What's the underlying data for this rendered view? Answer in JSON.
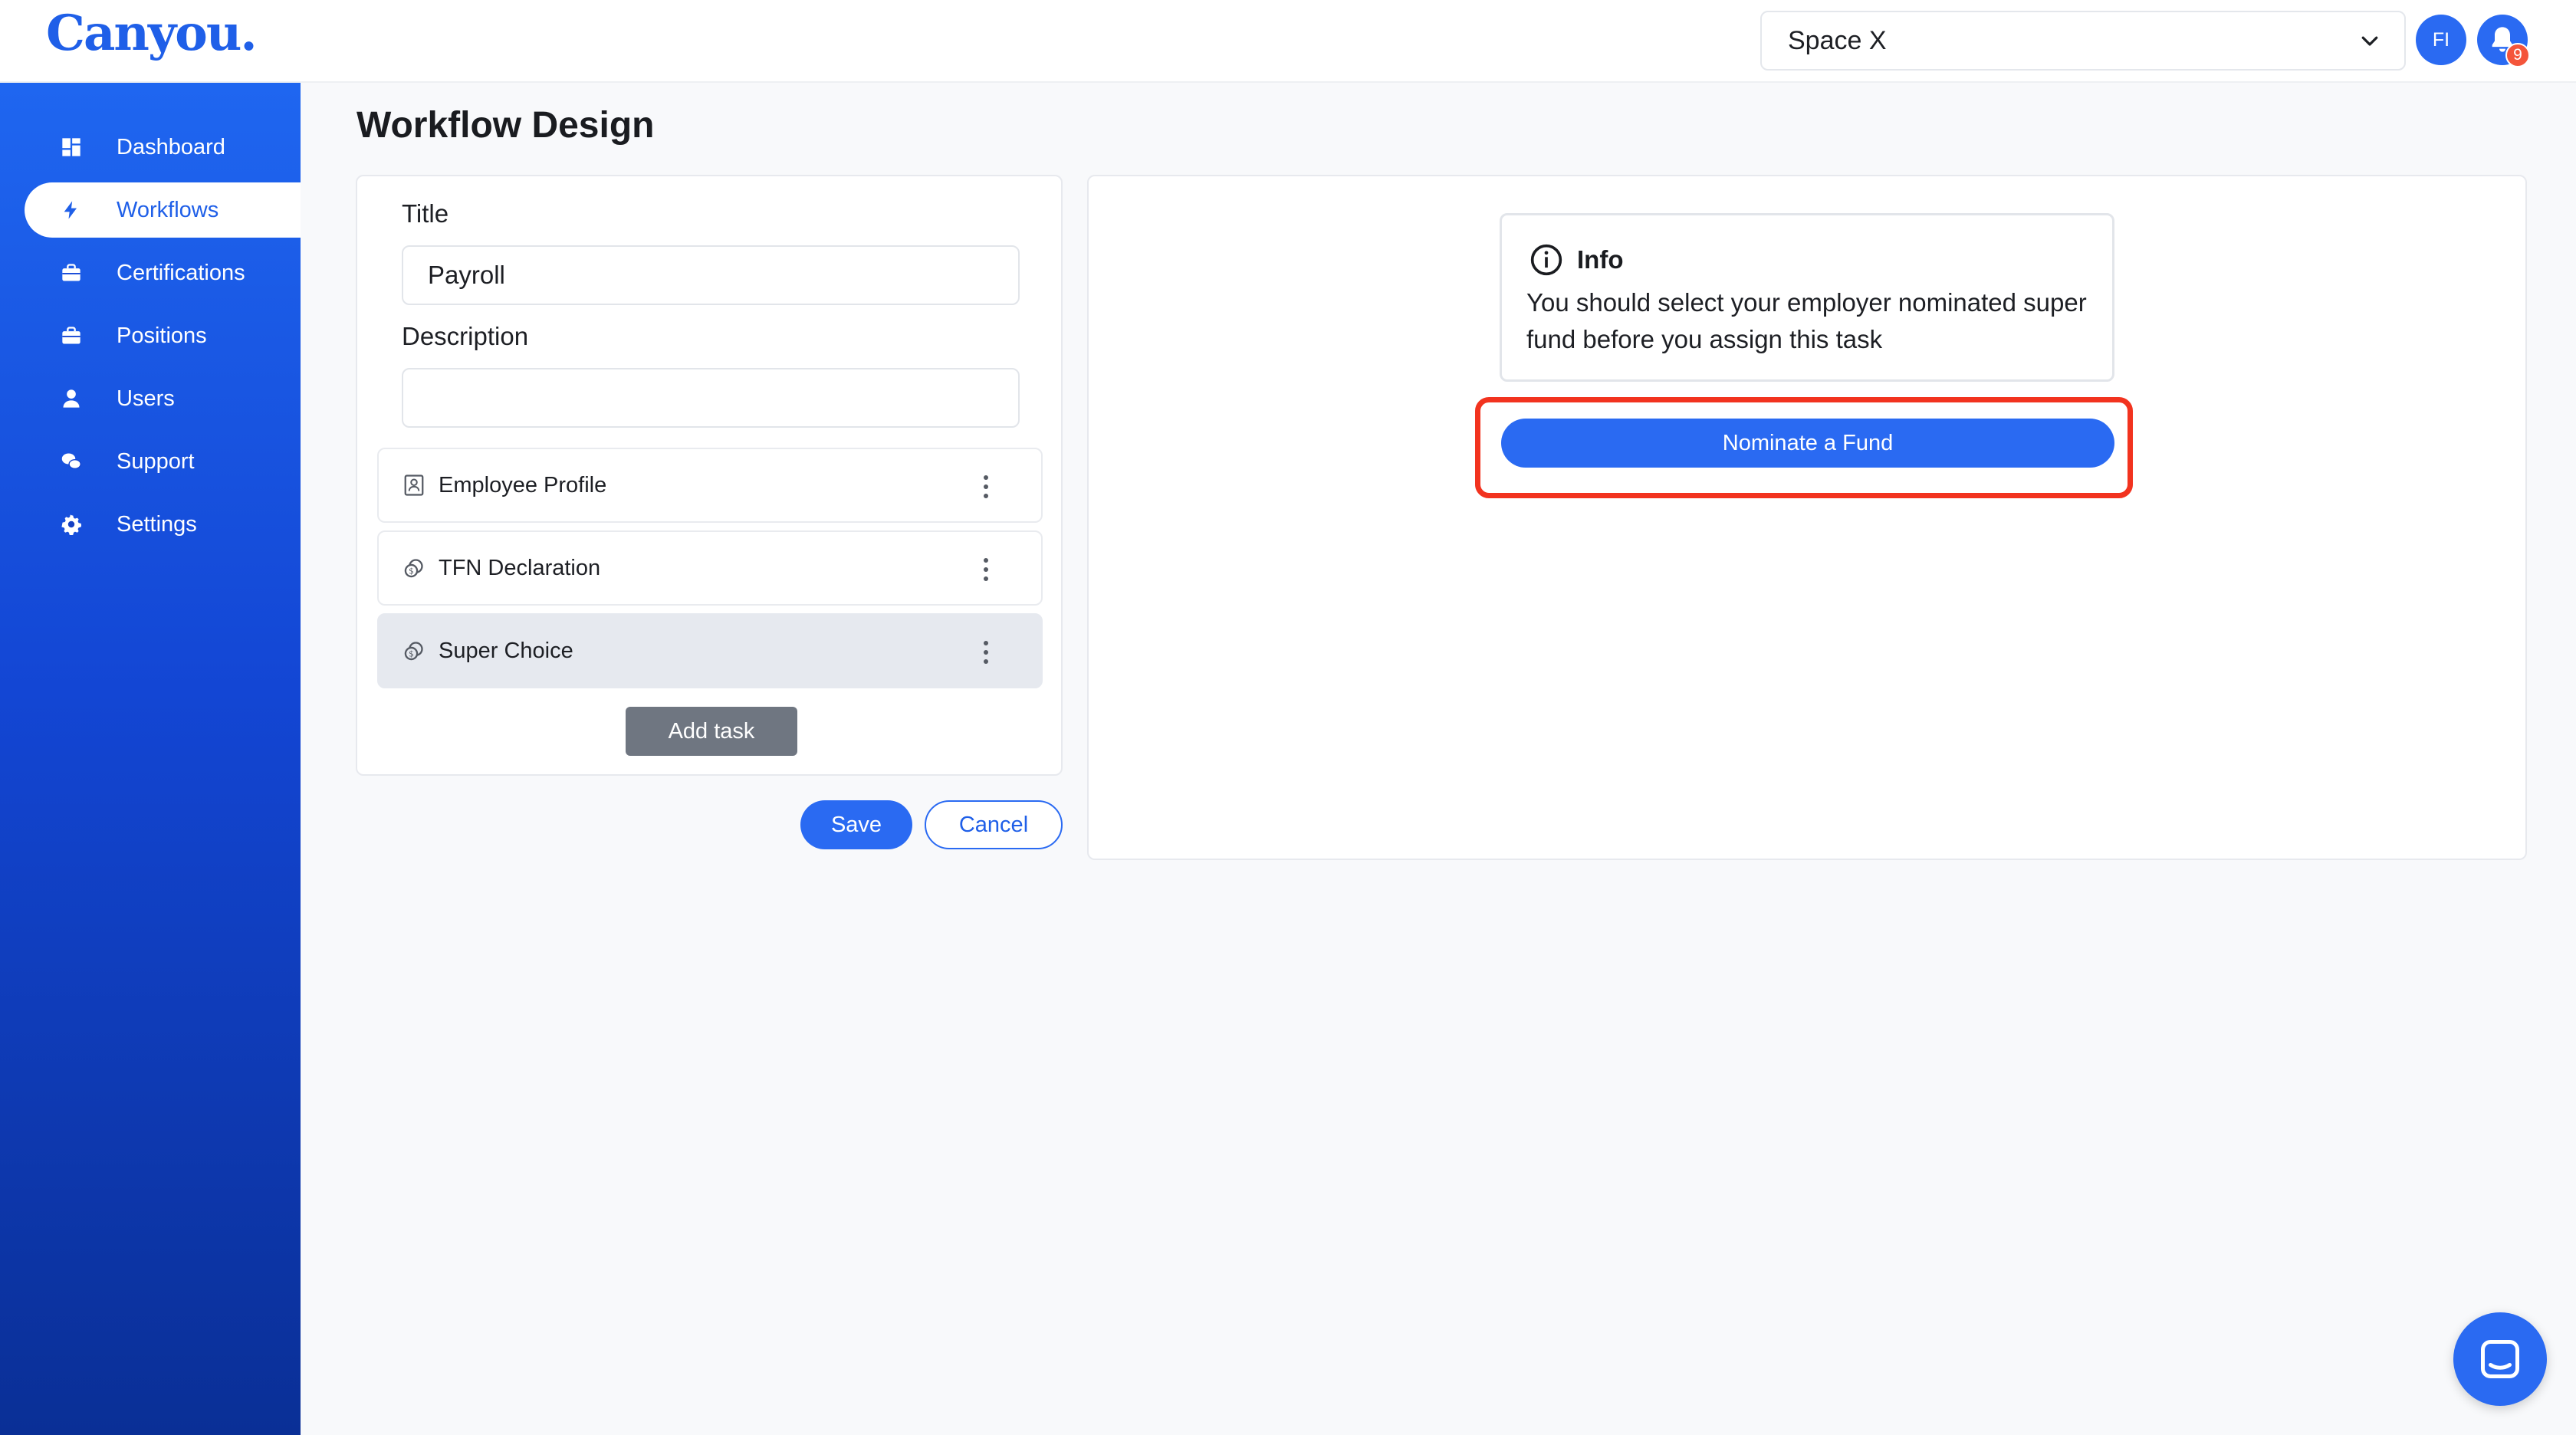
{
  "app": {
    "logo": "Canyou."
  },
  "header": {
    "space_selected": "Space X",
    "avatar_initials": "FI",
    "notification_count": "9"
  },
  "sidebar": {
    "items": [
      {
        "label": "Dashboard",
        "icon": "dashboard-icon",
        "active": false
      },
      {
        "label": "Workflows",
        "icon": "bolt-icon",
        "active": true
      },
      {
        "label": "Certifications",
        "icon": "briefcase-icon",
        "active": false
      },
      {
        "label": "Positions",
        "icon": "briefcase-icon",
        "active": false
      },
      {
        "label": "Users",
        "icon": "user-icon",
        "active": false
      },
      {
        "label": "Support",
        "icon": "chat-bubbles-icon",
        "active": false
      },
      {
        "label": "Settings",
        "icon": "gear-icon",
        "active": false
      }
    ]
  },
  "page": {
    "title": "Workflow Design"
  },
  "form": {
    "title_label": "Title",
    "title_value": "Payroll",
    "description_label": "Description",
    "description_value": "",
    "tasks": [
      {
        "label": "Employee Profile",
        "icon": "profile-card-icon",
        "selected": false
      },
      {
        "label": "TFN Declaration",
        "icon": "coins-icon",
        "selected": false
      },
      {
        "label": "Super Choice",
        "icon": "coins-icon",
        "selected": true
      }
    ],
    "add_task_label": "Add task",
    "save_label": "Save",
    "cancel_label": "Cancel"
  },
  "preview": {
    "info_title": "Info",
    "info_text": "You should select your employer nominated super fund before you assign this task",
    "nominate_label": "Nominate a Fund"
  },
  "colors": {
    "primary": "#2a6af2",
    "highlight": "#f2331f",
    "badge": "#f4553b"
  }
}
